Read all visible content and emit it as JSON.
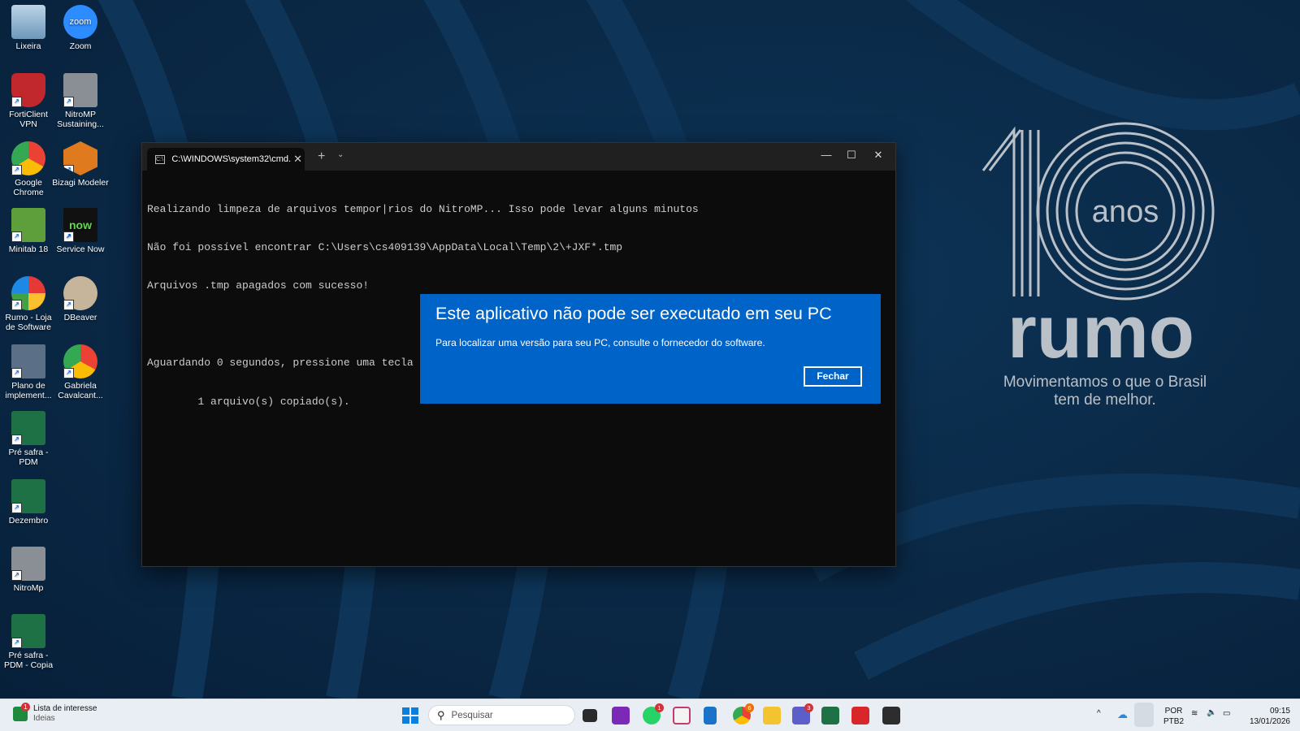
{
  "desktop_icons": [
    {
      "label": "Lixeira"
    },
    {
      "label": "Zoom",
      "glyph": "zoom"
    },
    {
      "label": "FortiClient VPN"
    },
    {
      "label": "NitroMP Sustaining..."
    },
    {
      "label": "Google Chrome"
    },
    {
      "label": "Bizagi Modeler"
    },
    {
      "label": "Minitab 18"
    },
    {
      "label": "Service Now",
      "glyph": "now"
    },
    {
      "label": "Rumo - Loja de Software"
    },
    {
      "label": "DBeaver"
    },
    {
      "label": "Plano de implement..."
    },
    {
      "label": "Gabriela Cavalcant..."
    },
    {
      "label": "Pré safra - PDM"
    },
    {
      "label": "Dezembro"
    },
    {
      "label": "NitroMp"
    },
    {
      "label": "Pré safra - PDM - Copia"
    }
  ],
  "terminal": {
    "tab_title": "C:\\WINDOWS\\system32\\cmd.",
    "tab_icon_text": "C:\\",
    "new_tab": "+",
    "dropdown": "⌄",
    "close_tab": "✕",
    "minimize": "—",
    "maximize": "☐",
    "close": "✕",
    "lines": [
      "Realizando limpeza de arquivos tempor|rios do NitroMP... Isso pode levar alguns minutos",
      "Não foi possível encontrar C:\\Users\\cs409139\\AppData\\Local\\Temp\\2\\+JXF*.tmp",
      "Arquivos .tmp apagados com sucesso!",
      "",
      "Aguardando 0 segundos, pressione uma tecla para continuar ...",
      "        1 arquivo(s) copiado(s)."
    ]
  },
  "dialog": {
    "title": "Este aplicativo não pode ser executado em seu PC",
    "message": "Para localizar uma versão para seu PC, consulte o fornecedor do software.",
    "button": "Fechar"
  },
  "wallpaper": {
    "anos": "anos",
    "brand": "rumo",
    "tagline_1": "Movimentamos o que o Brasil",
    "tagline_2": "tem de melhor."
  },
  "taskbar": {
    "widget_title": "Lista de interesse",
    "widget_sub": "Ideias",
    "widget_badge": "1",
    "search_placeholder": "Pesquisar",
    "whatsapp_badge": "1",
    "chrome_badge": "6",
    "teams_badge": "3",
    "language_1": "POR",
    "language_2": "PTB2",
    "time": "09:15",
    "date": "13/01/2026"
  },
  "colors": {
    "dialog_bg": "#0063c8",
    "wallpaper": "#0a2a48",
    "terminal_bg": "#0c0c0c"
  }
}
